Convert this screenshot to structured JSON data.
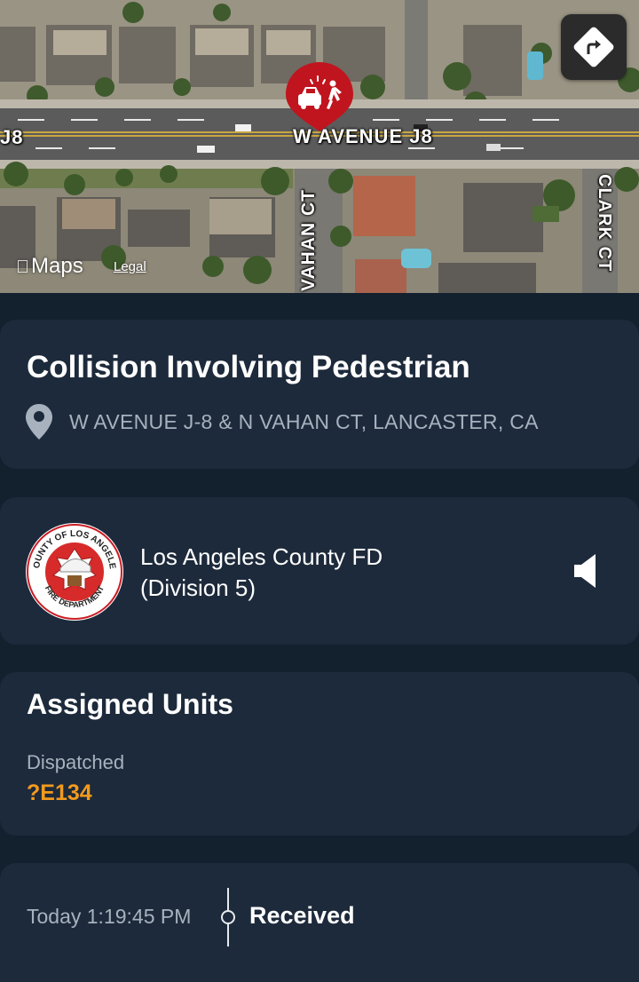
{
  "map": {
    "street_labels": {
      "avenue_left": "J8",
      "avenue_main": "W AVENUE J8",
      "vahan": "VAHAN CT",
      "clark": "CLARK CT"
    },
    "provider_label": "Maps",
    "legal_label": "Legal",
    "pin_icon": "vehicle-pedestrian-collision-icon",
    "pin_color": "#c0151e",
    "directions_icon": "directions-icon"
  },
  "incident": {
    "title": "Collision Involving Pedestrian",
    "location": "W AVENUE J-8 & N VAHAN CT, LANCASTER, CA",
    "location_icon": "location-pin-icon"
  },
  "agency": {
    "name_line1": "Los Angeles County FD",
    "name_line2": "(Division 5)",
    "logo_text_top": "COUNTY OF LOS ANGELES",
    "logo_text_bottom": "FIRE DEPARTMENT",
    "audio_icon": "speaker-icon"
  },
  "units": {
    "title": "Assigned Units",
    "status_label": "Dispatched",
    "unit": "?E134",
    "unit_color": "#f39a1d"
  },
  "timeline": {
    "time": "Today 1:19:45 PM",
    "event": "Received"
  },
  "colors": {
    "background": "#13202e",
    "card": "#1d2a3b",
    "muted_text": "#a7b2be"
  }
}
